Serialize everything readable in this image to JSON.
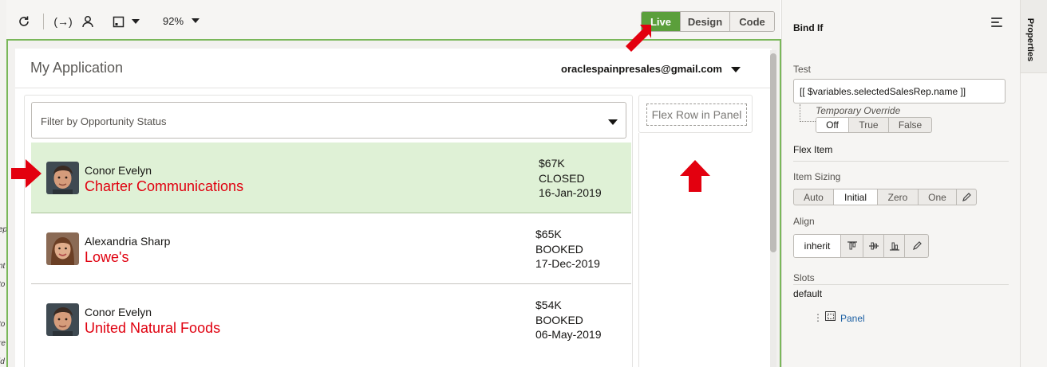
{
  "left_strip_fragments": [
    "ep",
    "nt",
    "to",
    "to",
    "re",
    "id"
  ],
  "toolbar": {
    "icons": [
      "refresh-icon",
      "variables-icon",
      "user-icon",
      "device-frame-icon",
      "caret-down-icon"
    ],
    "variables_glyph": "(→)",
    "zoom": "92%",
    "modes": [
      {
        "label": "Live",
        "active": true
      },
      {
        "label": "Design",
        "active": false
      },
      {
        "label": "Code",
        "active": false
      }
    ]
  },
  "app": {
    "title": "My Application",
    "user_email": "oraclespainpresales@gmail.com",
    "filter_placeholder": "Filter by Opportunity Status",
    "flex_row_label": "Flex Row in Panel",
    "opportunities": [
      {
        "name": "Conor Evelyn",
        "company": "Charter Communications",
        "amount": "$67K",
        "status": "CLOSED",
        "date": "16-Jan-2019",
        "selected": true,
        "avatar": "male"
      },
      {
        "name": "Alexandria Sharp",
        "company": "Lowe's",
        "amount": "$65K",
        "status": "BOOKED",
        "date": "17-Dec-2019",
        "selected": false,
        "avatar": "female"
      },
      {
        "name": "Conor Evelyn",
        "company": "United Natural Foods",
        "amount": "$54K",
        "status": "BOOKED",
        "date": "06-May-2019",
        "selected": false,
        "avatar": "male"
      }
    ]
  },
  "properties": {
    "title": "Bind If",
    "test_label": "Test",
    "test_value": "[[ $variables.selectedSalesRep.name ]]",
    "temporary_override_label": "Temporary Override",
    "override_options": [
      {
        "label": "Off",
        "selected": true
      },
      {
        "label": "True",
        "selected": false
      },
      {
        "label": "False",
        "selected": false
      }
    ],
    "flex_item_label": "Flex Item",
    "item_sizing_label": "Item Sizing",
    "item_sizing_options": [
      {
        "label": "Auto",
        "selected": false
      },
      {
        "label": "Initial",
        "selected": true
      },
      {
        "label": "Zero",
        "selected": false
      },
      {
        "label": "One",
        "selected": false
      }
    ],
    "align_label": "Align",
    "align_value": "inherit",
    "slots_label": "Slots",
    "default_slot_label": "default",
    "slot_item": "Panel"
  },
  "side_tab": "Properties",
  "colors": {
    "accent_green": "#5b9f3b",
    "selected_row": "#dff1d6",
    "company_red": "#e0000f",
    "annotation_arrow": "#e3000f",
    "link_blue": "#1b5fa3"
  }
}
